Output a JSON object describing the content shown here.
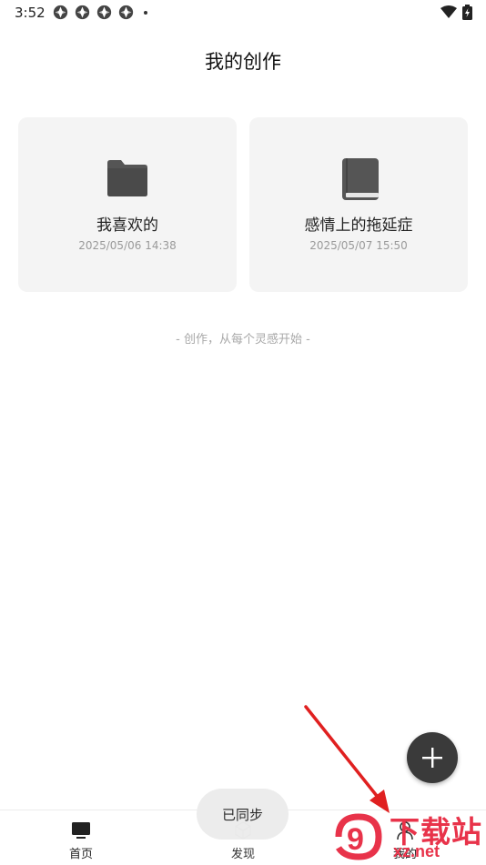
{
  "status_bar": {
    "time": "3:52",
    "notification_icons": [
      "app-notification-icon",
      "app-notification-icon",
      "app-notification-icon",
      "app-notification-icon"
    ],
    "wifi_icon": "wifi-icon",
    "battery_icon": "battery-charging-icon"
  },
  "header": {
    "title": "我的创作"
  },
  "works": [
    {
      "icon": "folder-icon",
      "name": "我喜欢的",
      "date": "2025/05/06 14:38"
    },
    {
      "icon": "book-icon",
      "name": "感情上的拖延症",
      "date": "2025/05/07 15:50"
    }
  ],
  "tagline": "- 创作，从每个灵感开始 -",
  "fab": {
    "icon": "plus-icon"
  },
  "toast": {
    "text": "已同步"
  },
  "bottom_nav": {
    "items": [
      {
        "label": "首页",
        "icon": "monitor-icon"
      },
      {
        "label": "发现",
        "icon": "cube-icon"
      },
      {
        "label": "我的",
        "icon": "person-icon"
      }
    ]
  },
  "watermark": {
    "brand": "下载站",
    "url": "xz.net",
    "logo_text": "9"
  },
  "colors": {
    "card_background": "#f4f4f4",
    "fab": "#3a3a3a",
    "watermark": "#e8334a",
    "annotation_arrow": "#e02020"
  }
}
